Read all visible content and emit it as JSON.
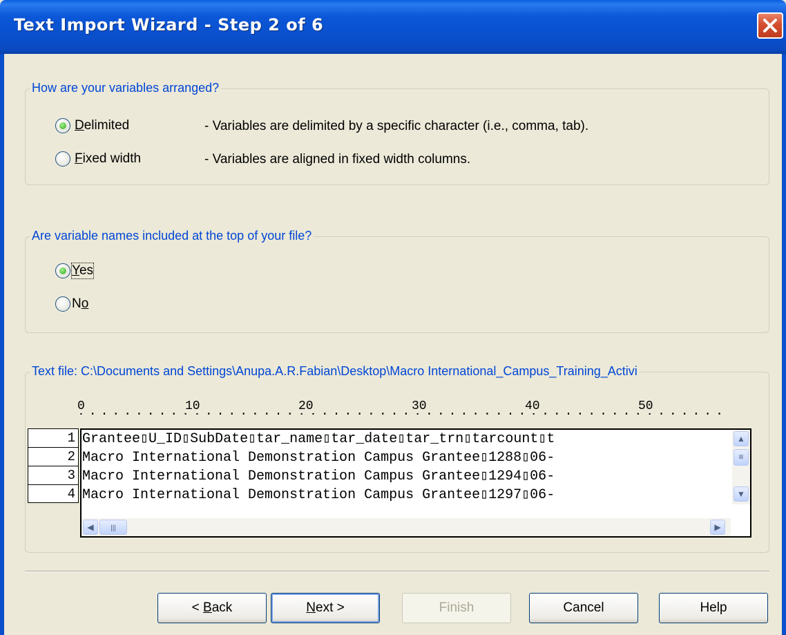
{
  "window": {
    "title": "Text Import Wizard - Step 2 of 6"
  },
  "arrangement": {
    "legend": "How are your variables arranged?",
    "options": [
      {
        "label": "Delimited",
        "mnemonic": "D",
        "description": "- Variables are delimited by a specific character (i.e., comma, tab).",
        "checked": true
      },
      {
        "label": "Fixed width",
        "mnemonic": "F",
        "description": "- Variables are aligned in fixed width columns.",
        "checked": false
      }
    ]
  },
  "names": {
    "legend": "Are variable names included at the top of your file?",
    "options": [
      {
        "label": "Yes",
        "checked": true
      },
      {
        "label": "No",
        "checked": false
      }
    ]
  },
  "textfile": {
    "legend": "Text file: C:\\Documents and Settings\\Anupa.A.R.Fabian\\Desktop\\Macro International_Campus_Training_Activi",
    "ruler": [
      "0",
      "10",
      "20",
      "30",
      "40",
      "50"
    ],
    "line_numbers": [
      "1",
      "2",
      "3",
      "4"
    ],
    "lines": [
      "Grantee▯U_ID▯SubDate▯tar_name▯tar_date▯tar_trn▯tarcount▯t",
      "Macro International Demonstration Campus Grantee▯1288▯06-",
      "Macro International Demonstration Campus Grantee▯1294▯06-",
      "Macro International Demonstration Campus Grantee▯1297▯06-"
    ]
  },
  "buttons": {
    "back": "< Back",
    "next": "Next >",
    "finish": "Finish",
    "cancel": "Cancel",
    "help": "Help"
  },
  "icons": {
    "close": "close-icon",
    "scroll_up": "arrow-up-icon",
    "scroll_down": "arrow-down-icon",
    "scroll_left": "arrow-left-icon",
    "scroll_right": "arrow-right-icon"
  }
}
